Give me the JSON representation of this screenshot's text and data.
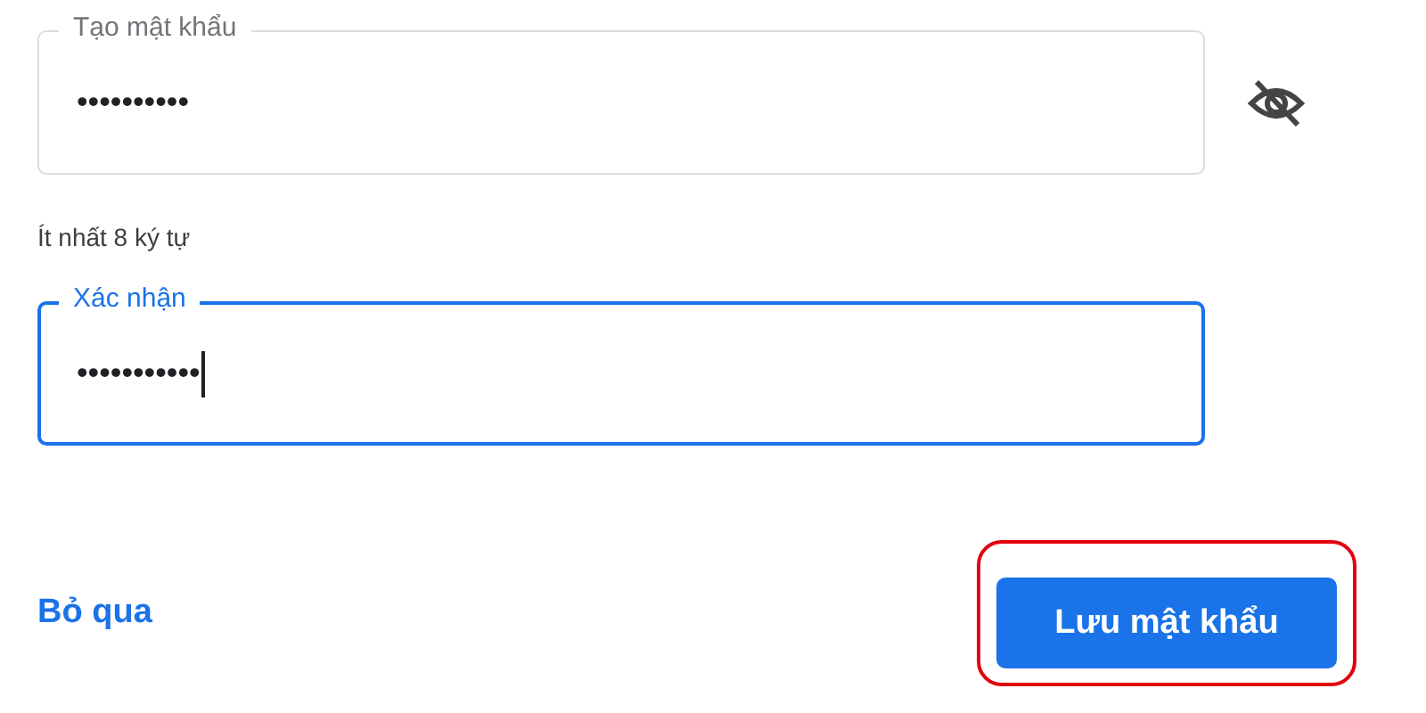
{
  "fields": [
    {
      "label": "Tạo mật khẩu",
      "value": "••••••••••",
      "focused": false,
      "visibility_toggle": true
    },
    {
      "label": "Xác nhận",
      "value": "•••••••••••",
      "focused": true,
      "visibility_toggle": false
    }
  ],
  "helper_text": "Ít nhất 8 ký tự",
  "skip_link": "Bỏ qua",
  "save_button": {
    "label": "Lưu mật khẩu",
    "highlighted": true
  }
}
